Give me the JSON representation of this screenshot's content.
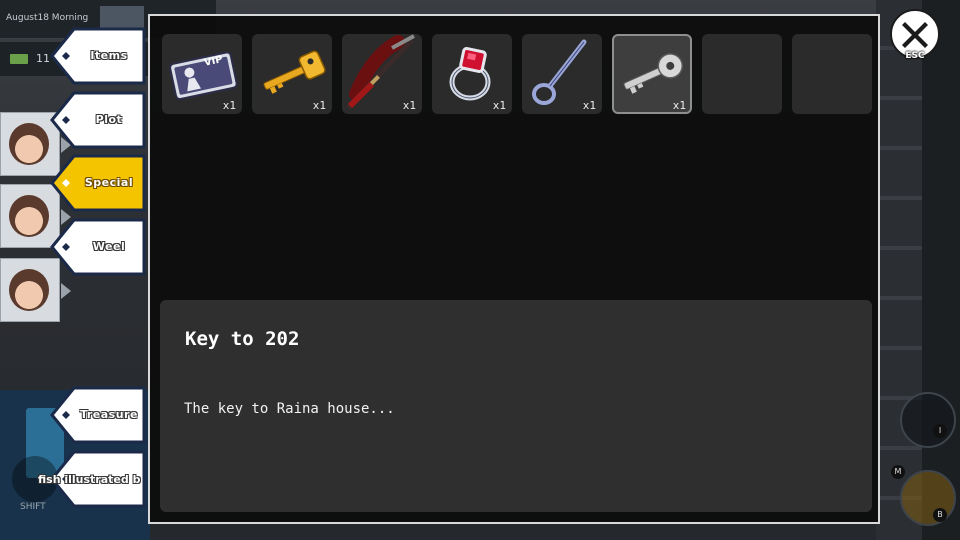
{
  "hud": {
    "date_time": "August18 Morning",
    "money": "11",
    "shift_label": "SHIFT",
    "key_i": "I",
    "key_m": "M",
    "key_b": "B"
  },
  "tabs": [
    {
      "label": "Items",
      "active": false
    },
    {
      "label": "Plot",
      "active": false
    },
    {
      "label": "Special",
      "active": true
    },
    {
      "label": "Weel",
      "active": false
    },
    {
      "label": "Treasure",
      "active": false
    },
    {
      "label": "fish illustrated b",
      "active": false
    }
  ],
  "inventory": {
    "slots": [
      {
        "item": "vip-card-icon",
        "count": "x1",
        "selected": false
      },
      {
        "item": "gold-key-icon",
        "count": "x1",
        "selected": false
      },
      {
        "item": "katana-icon",
        "count": "x1",
        "selected": false
      },
      {
        "item": "ruby-ring-icon",
        "count": "x1",
        "selected": false
      },
      {
        "item": "slingshot-icon",
        "count": "x1",
        "selected": false
      },
      {
        "item": "silver-key-icon",
        "count": "x1",
        "selected": true
      },
      {
        "item": "",
        "count": "",
        "selected": false
      },
      {
        "item": "",
        "count": "",
        "selected": false
      }
    ],
    "vip_text": "VIP"
  },
  "description": {
    "title": "Key to 202",
    "text": "The key to Raina house..."
  },
  "close": {
    "label": "ESC"
  },
  "colors": {
    "tab_active": "#f5c400",
    "tab_inactive": "#ffffff",
    "tab_border": "#1c2a4a",
    "panel_bg": "#0c0c0c",
    "slot_bg": "#2b2b2b",
    "desc_bg": "#2f2f2f"
  }
}
